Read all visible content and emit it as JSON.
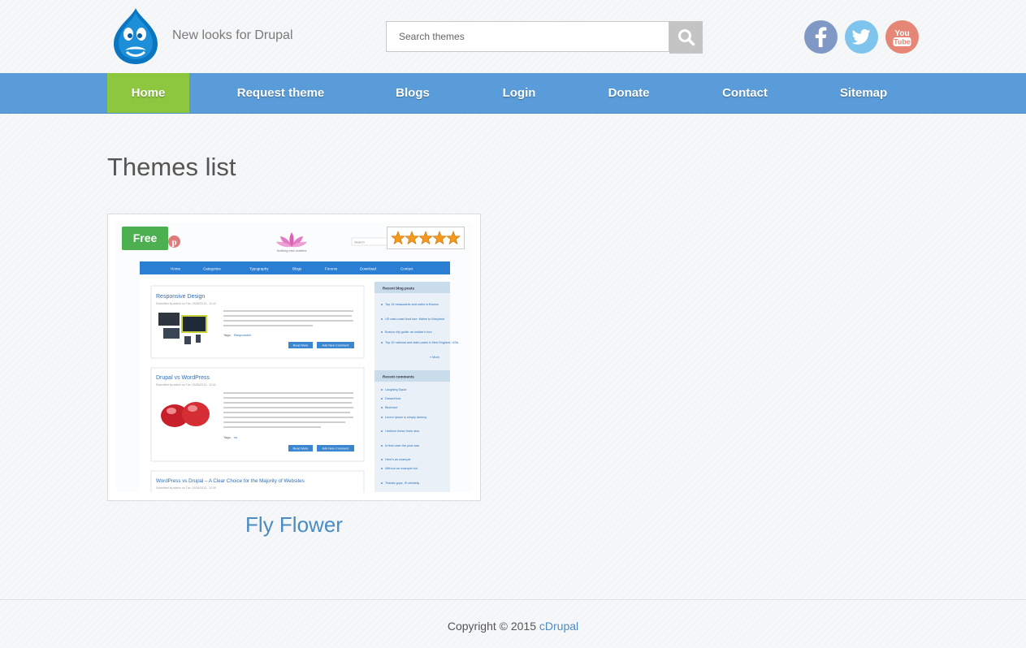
{
  "header": {
    "logo_name": "drupal-drop-logo",
    "slogan": "New looks for Drupal",
    "search": {
      "placeholder": "Search themes",
      "value": ""
    },
    "social": [
      {
        "name": "facebook",
        "icon": "facebook-icon",
        "color": "#7f98c6"
      },
      {
        "name": "twitter",
        "icon": "twitter-icon",
        "color": "#7ec4ec"
      },
      {
        "name": "youtube",
        "icon": "youtube-icon",
        "color": "#e58677"
      }
    ]
  },
  "nav": {
    "active_index": 0,
    "colors": {
      "bar": "#5a9cd9",
      "active": "#8dc63f"
    },
    "items": [
      {
        "label": "Home"
      },
      {
        "label": "Request theme"
      },
      {
        "label": "Blogs"
      },
      {
        "label": "Login"
      },
      {
        "label": "Donate"
      },
      {
        "label": "Contact"
      },
      {
        "label": "Sitemap"
      }
    ]
  },
  "main": {
    "title": "Themes list",
    "themes": [
      {
        "name": "Fly Flower",
        "badge": "Free",
        "rating": 5,
        "rating_max": 5,
        "preview": {
          "site_slogan": "Nothing else matters",
          "search_placeholder": "Search",
          "menu": [
            "Home",
            "Categories",
            "Typography",
            "Blogs",
            "Forums",
            "Download",
            "Contact"
          ],
          "posts": [
            {
              "title": "Responsive Design",
              "meta": "Submitted by admin on Tue, 03/26/2013 - 12:42",
              "tags": "Tags:",
              "tag": "Responsive",
              "read_more": "Read More",
              "add_comment": "Add New Comment"
            },
            {
              "title": "Drupal vs WordPress",
              "meta": "Submitted by admin on Tue, 03/26/2013 - 12:41",
              "tags": "Tags:",
              "tag": "vs",
              "read_more": "Read More",
              "add_comment": "Add New Comment"
            },
            {
              "title": "WordPress vs Drupal – A Clear Choice for the Majority of Websites",
              "meta": "Submitted by admin on Tue, 03/26/2013 - 12:39"
            }
          ],
          "sidebar": {
            "blog_heading": "Recent blog posts",
            "blog_items": [
              "Top 15 restaurants and cafes in Boston",
              "US east coast food tour: Maine to Maryland",
              "Boston city guide: an insider's tour",
              "Top 10 national and state parks in New England, USA"
            ],
            "more": "» More",
            "comments_heading": "Recent comments",
            "comment_items": [
              "Laughing Squid",
              "DreamHost",
              "Bluehost",
              "Lorem Ipsum is simply dummy",
              "I believe these three also",
              "In that case the post was",
              "Here's an example",
              "Without an example but",
              "Thanks guys, I'll certainly"
            ]
          }
        }
      }
    ]
  },
  "footer": {
    "copyright": "Copyright © 2015",
    "link": "cDrupal"
  }
}
